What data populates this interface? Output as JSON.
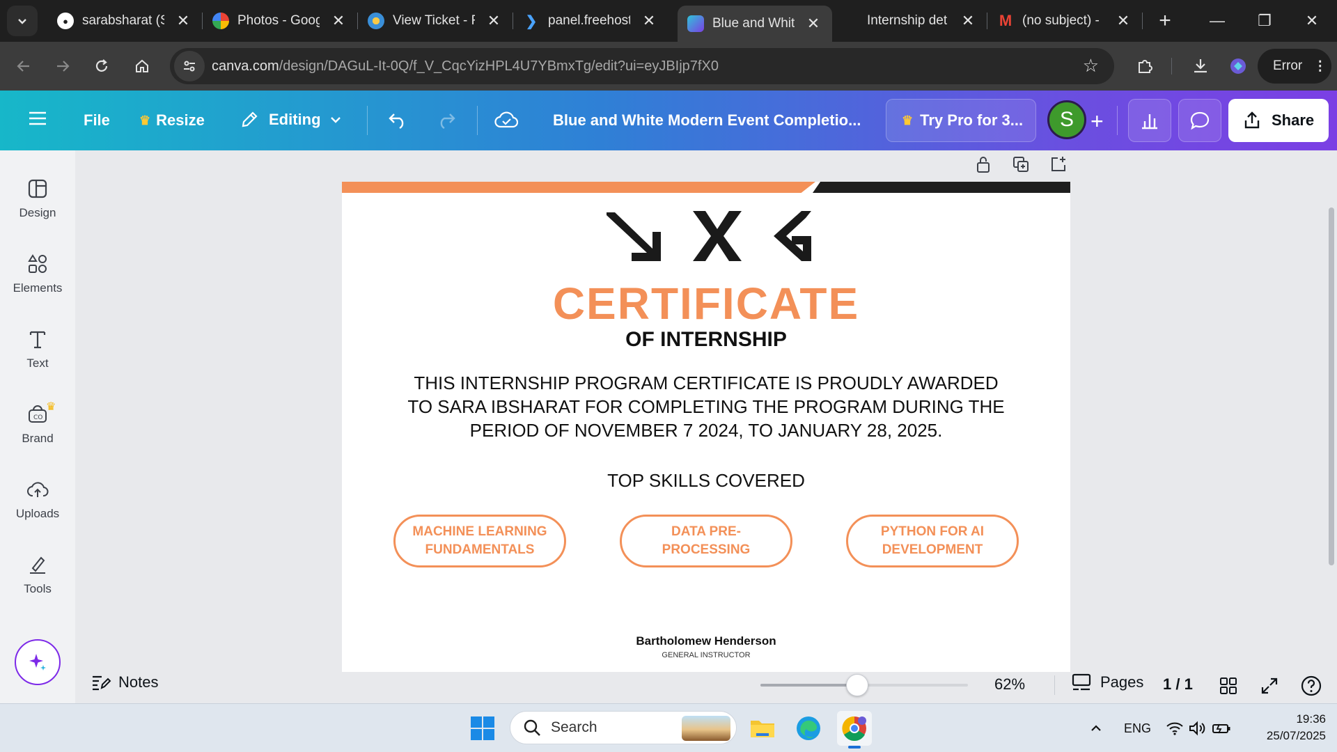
{
  "browser": {
    "tabs": [
      {
        "title": "sarabsharat (S",
        "favicon": "github-icon",
        "active": false
      },
      {
        "title": "Photos - Goog",
        "favicon": "google-photos-icon",
        "active": false
      },
      {
        "title": "View Ticket - F",
        "favicon": "ticket-icon",
        "active": false
      },
      {
        "title": "panel.freehost",
        "favicon": "panel-icon",
        "active": false
      },
      {
        "title": "Blue and Whit",
        "favicon": "canva-icon",
        "active": true
      },
      {
        "title": "Internship det",
        "favicon": "blank-icon",
        "active": false
      },
      {
        "title": "(no subject) -",
        "favicon": "gmail-icon",
        "active": false
      }
    ],
    "url_host": "canva.com",
    "url_path": "/design/DAGuL-It-0Q/f_V_CqcYizHPL4U7YBmxTg/edit?ui=eyJBIjp7fX0",
    "profile_label": "Error"
  },
  "canva": {
    "menu": {
      "file_label": "File",
      "resize_label": "Resize",
      "editing_label": "Editing"
    },
    "doc_title": "Blue and White Modern Event Completio...",
    "try_pro_label": "Try Pro for 3...",
    "avatar_initial": "S",
    "share_label": "Share",
    "sidebar": [
      {
        "label": "Design",
        "icon": "design-icon"
      },
      {
        "label": "Elements",
        "icon": "elements-icon"
      },
      {
        "label": "Text",
        "icon": "text-icon"
      },
      {
        "label": "Brand",
        "icon": "brand-icon"
      },
      {
        "label": "Uploads",
        "icon": "uploads-icon"
      },
      {
        "label": "Tools",
        "icon": "tools-icon"
      }
    ],
    "certificate": {
      "title": "CERTIFICATE",
      "subtitle": "OF INTERNSHIP",
      "body": "THIS INTERNSHIP PROGRAM CERTIFICATE IS PROUDLY AWARDED TO SARA IBSHARAT FOR COMPLETING THE PROGRAM DURING THE PERIOD OF NOVEMBER 7 2024, TO JANUARY 28, 2025.",
      "skills_heading": "TOP SKILLS COVERED",
      "skills": [
        "MACHINE LEARNING FUNDAMENTALS",
        "DATA PRE-PROCESSING",
        "PYTHON FOR AI DEVELOPMENT"
      ],
      "signer_name": "Bartholomew Henderson",
      "signer_role": "GENERAL INSTRUCTOR",
      "accent_color": "#f39058"
    },
    "status": {
      "notes_label": "Notes",
      "zoom_level": 0.62,
      "zoom_label": "62%",
      "pages_label": "Pages",
      "page_count": "1 / 1"
    }
  },
  "taskbar": {
    "search_placeholder": "Search",
    "language": "ENG",
    "time": "19:36",
    "date": "25/07/2025"
  }
}
